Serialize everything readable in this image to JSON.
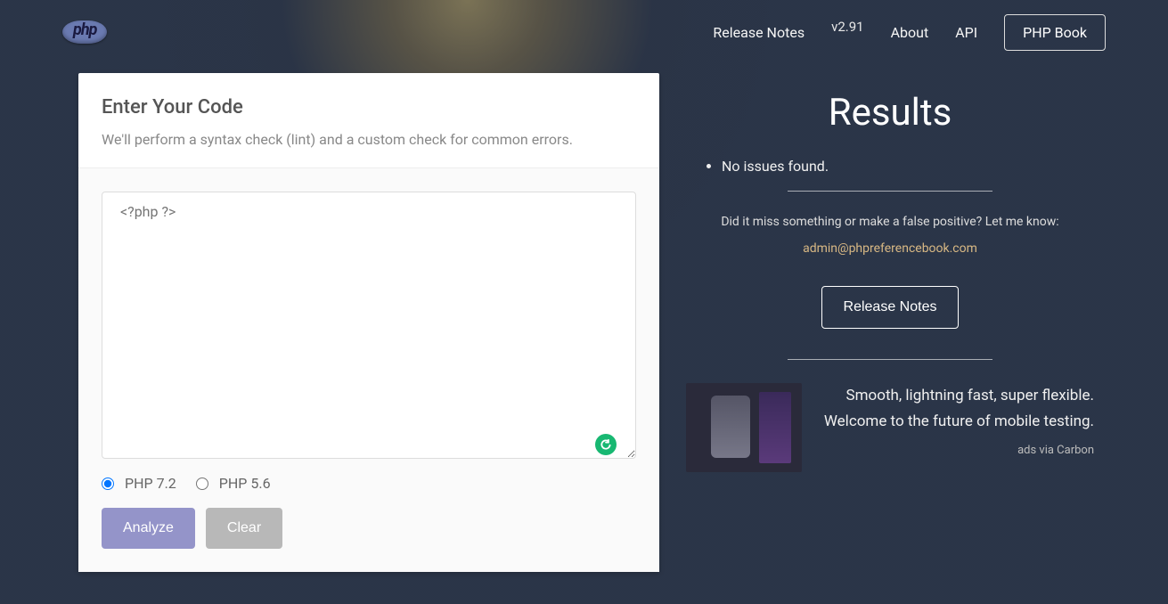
{
  "nav": {
    "logo_text": "php",
    "release_notes": "Release Notes",
    "version": "v2.91",
    "about": "About",
    "api": "API",
    "php_book": "PHP Book"
  },
  "form": {
    "title": "Enter Your Code",
    "subtitle": "We'll perform a syntax check (lint) and a custom check for common errors.",
    "placeholder": "<?php ?>",
    "value": "",
    "php72_label": "PHP 7.2",
    "php56_label": "PHP 5.6",
    "selected_version": "7.2",
    "analyze_label": "Analyze",
    "clear_label": "Clear"
  },
  "results": {
    "title": "Results",
    "items": [
      "No issues found."
    ],
    "feedback_prompt": "Did it miss something or make a false positive? Let me know:",
    "email": "admin@phpreferencebook.com",
    "release_notes_label": "Release Notes"
  },
  "ad": {
    "line1": "Smooth, lightning fast, super flexible.",
    "line2": "Welcome to the future of mobile testing.",
    "via": "ads via Carbon"
  }
}
